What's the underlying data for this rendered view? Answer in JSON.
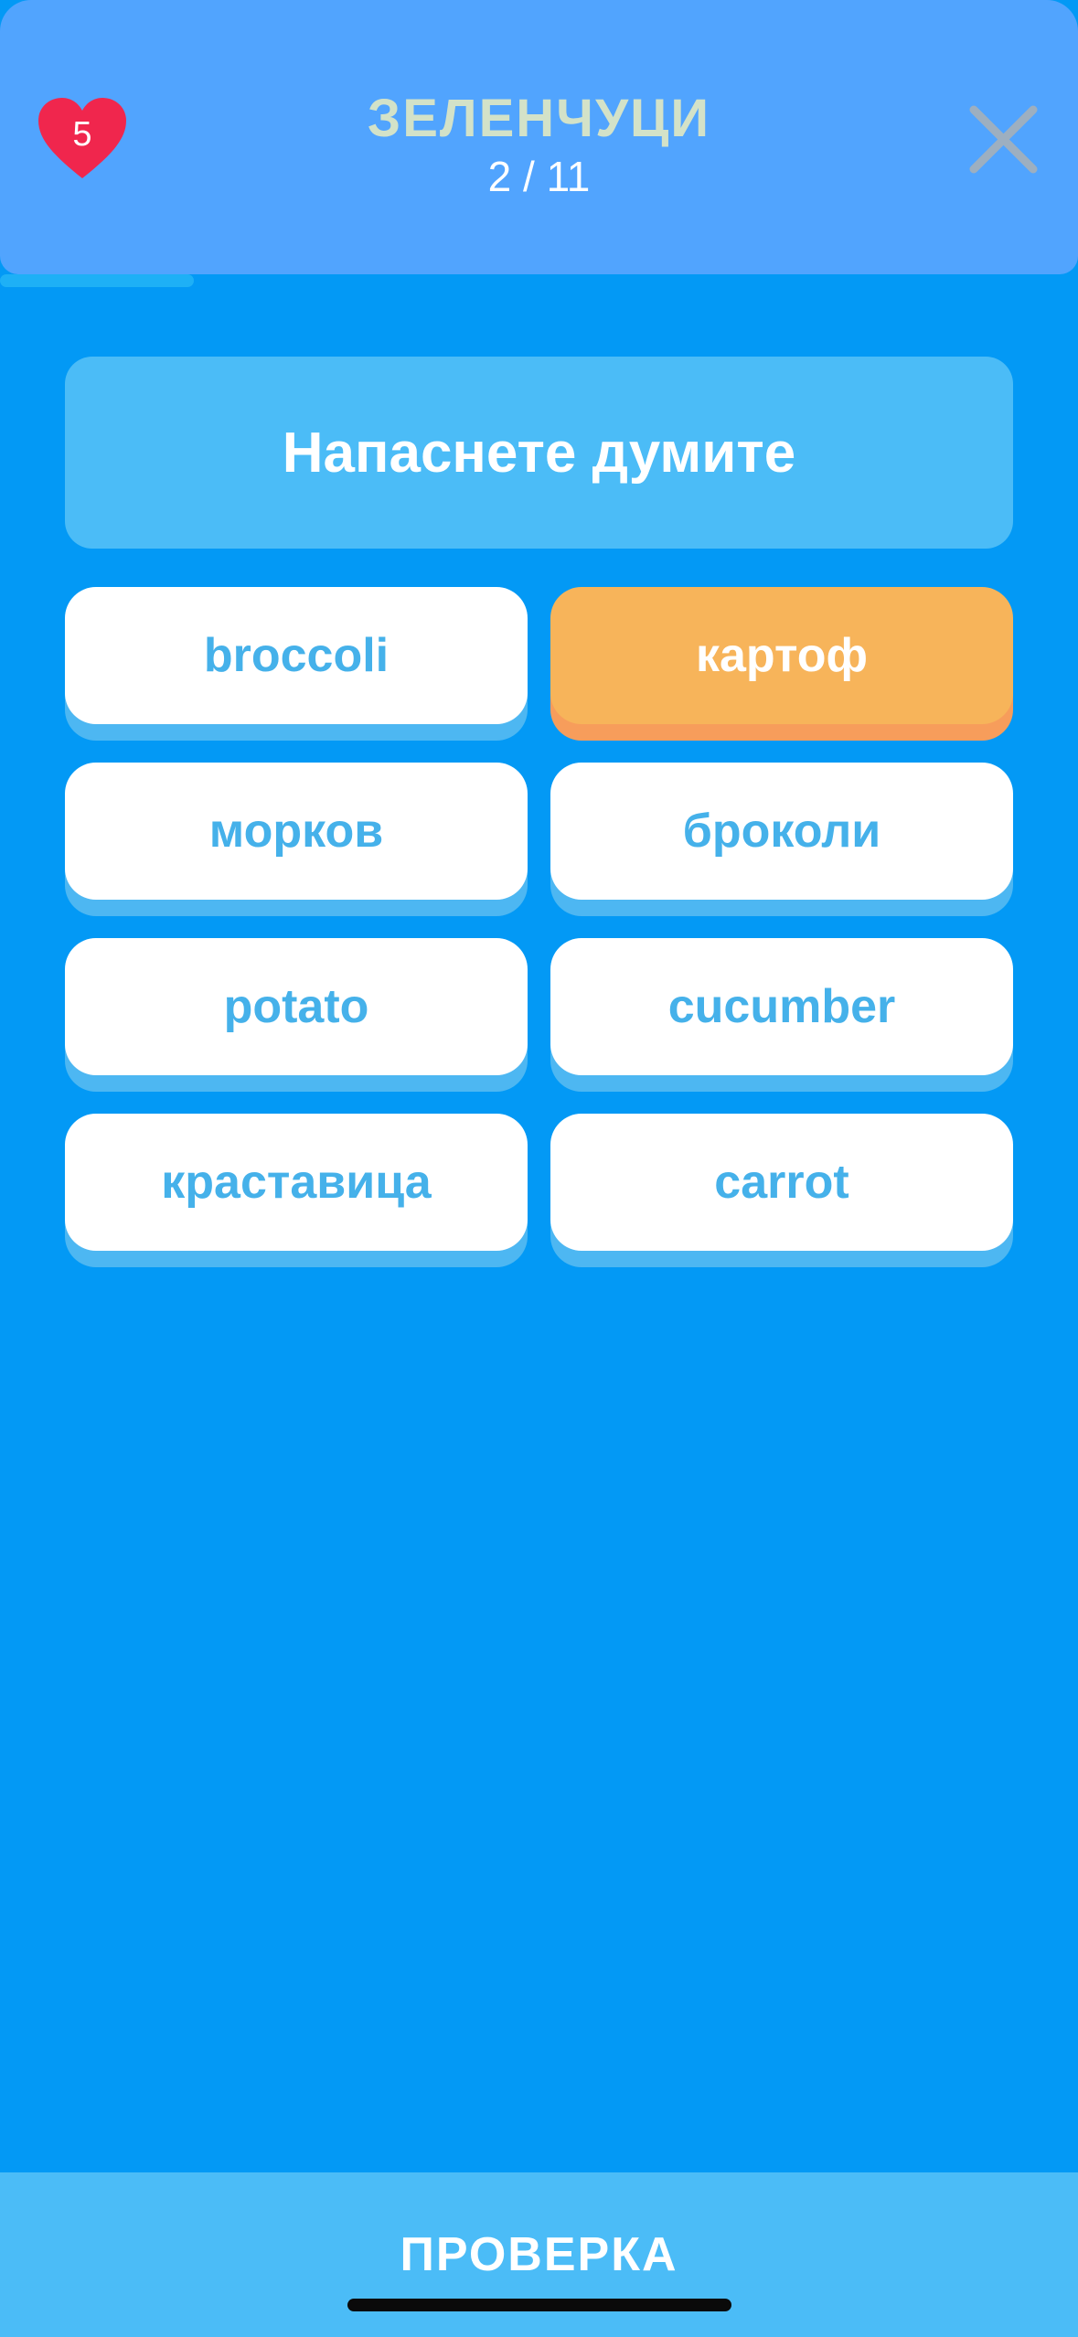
{
  "header": {
    "lives": "5",
    "title": "ЗЕЛЕНЧУЦИ",
    "counter": "2 / 11",
    "progress": 0.18
  },
  "icons": {
    "lives": "heart-icon",
    "close": "close-icon"
  },
  "instruction": "Напаснете думите",
  "cards": [
    {
      "label": "broccoli",
      "selected": false
    },
    {
      "label": "картоф",
      "selected": true
    },
    {
      "label": "морков",
      "selected": false
    },
    {
      "label": "броколи",
      "selected": false
    },
    {
      "label": "potato",
      "selected": false
    },
    {
      "label": "cucumber",
      "selected": false
    },
    {
      "label": "краставица",
      "selected": false
    },
    {
      "label": "carrot",
      "selected": false
    }
  ],
  "footer": {
    "check_label": "ПРОВЕРКА"
  },
  "colors": {
    "background": "#0399F5",
    "header": "#51A4FE",
    "card": "#FFFFFF",
    "card_text": "#45B1EA",
    "selected_card": "#F7B45A",
    "heart": "#F0264D"
  }
}
